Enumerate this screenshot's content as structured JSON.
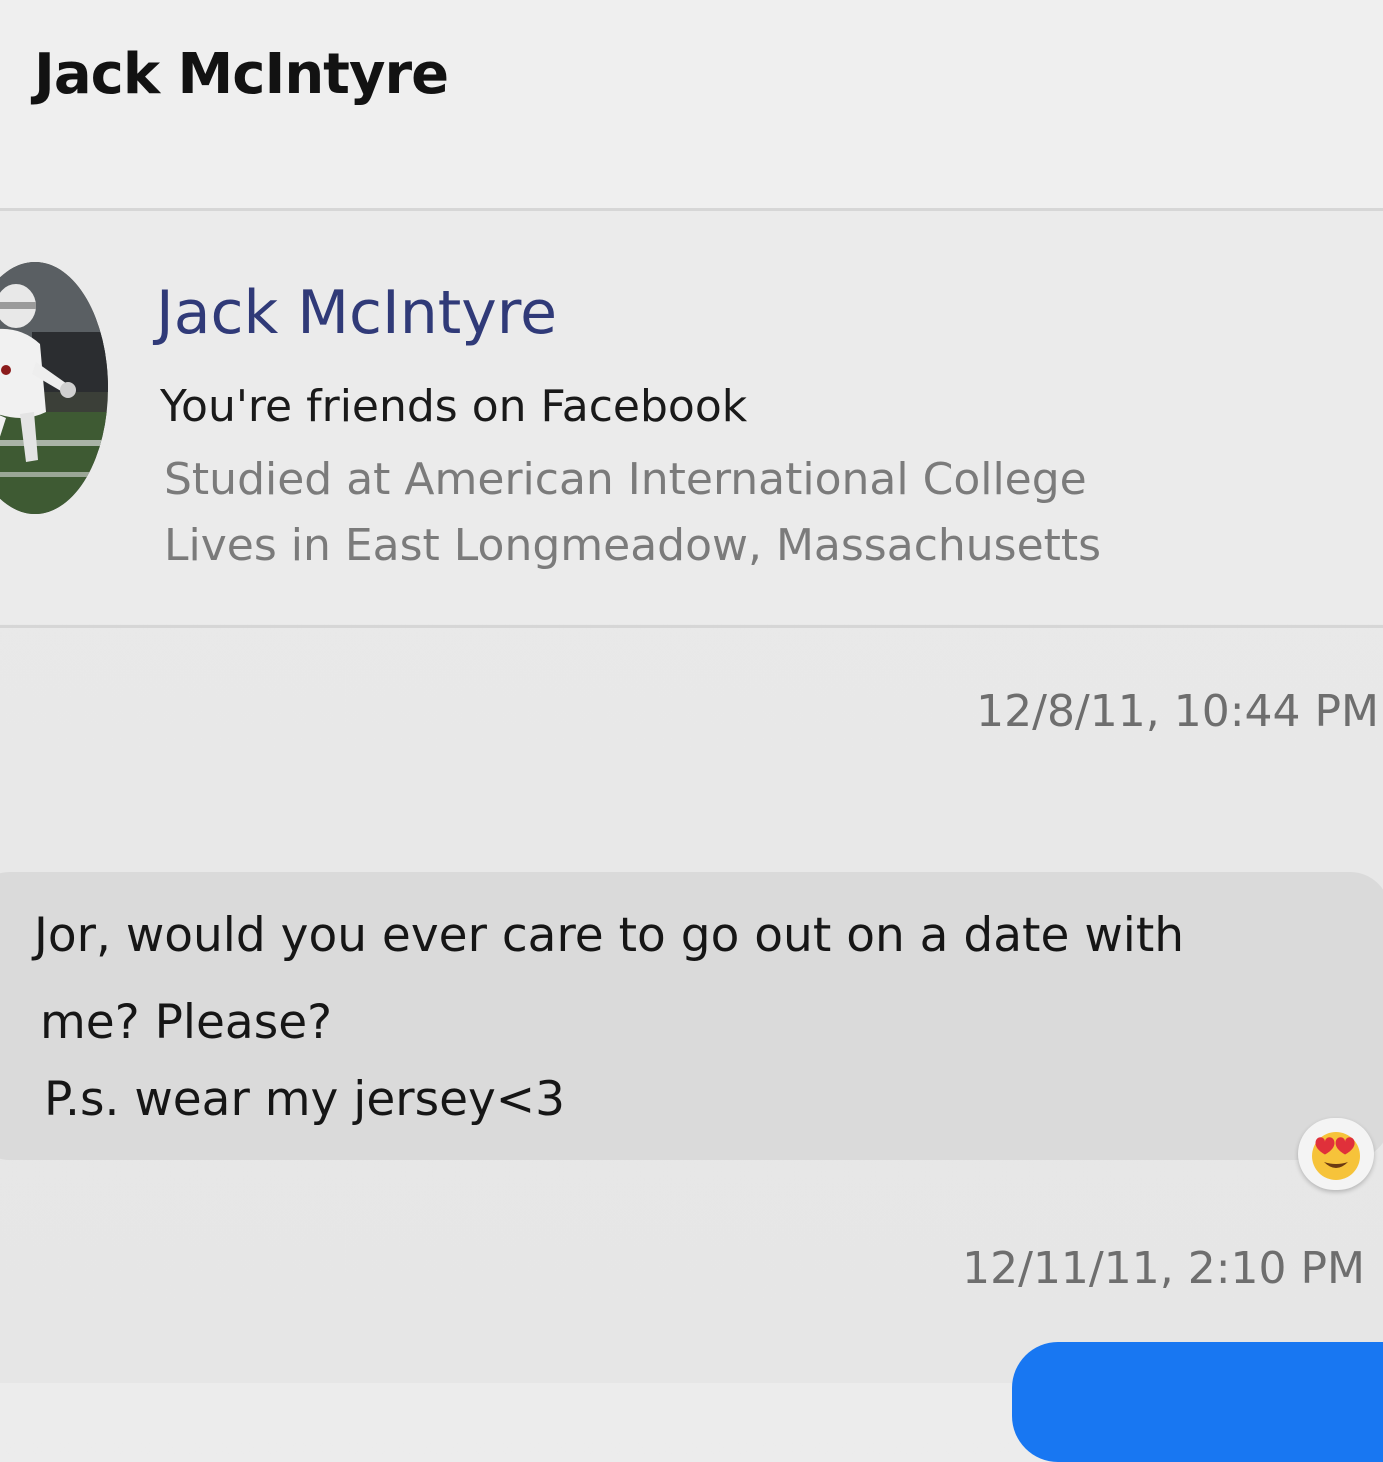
{
  "header": {
    "title": "Jack McIntyre"
  },
  "profile": {
    "name": "Jack McIntyre",
    "relationship": "You're friends on Facebook",
    "education": "Studied at American International College",
    "location": "Lives in East Longmeadow, Massachusetts"
  },
  "conversation": {
    "first_timestamp": "12/8/11, 10:44 PM",
    "message_lines": [
      "Jor, would you ever care to go out on a date with",
      "me? Please?",
      "P.s. wear my jersey<3"
    ],
    "reaction_icon": "heart-eyes-emoji-icon",
    "second_timestamp": "12/11/11, 2:10 PM"
  },
  "colors": {
    "profile_name": "#303a78",
    "sent_bubble": "#1877f2",
    "received_bubble": "#dadada"
  }
}
